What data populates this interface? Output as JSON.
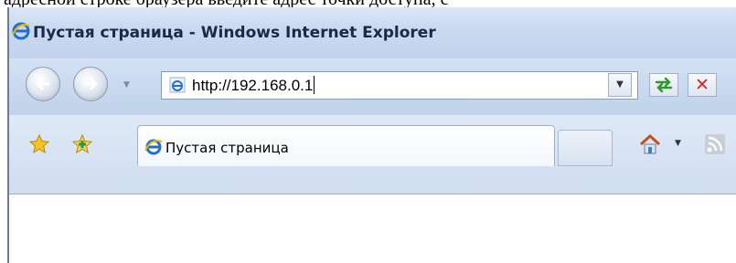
{
  "document": {
    "top_text": "адресной строке браузера введите адрес точки доступа, с"
  },
  "window": {
    "title": "Пустая страница - Windows Internet Explorer"
  },
  "address_bar": {
    "url": "http://192.168.0.1"
  },
  "tab": {
    "label": "Пустая страница"
  },
  "icons": {
    "title": "ie-logo-icon",
    "back": "back-arrow-icon",
    "forward": "forward-arrow-icon",
    "address": "ie-page-icon",
    "refresh": "refresh-icon",
    "stop": "stop-icon",
    "favorites": "favorites-star-icon",
    "add_favorite": "add-favorite-icon",
    "home": "home-icon",
    "feeds": "feeds-icon"
  },
  "colors": {
    "chrome": "#c9d9f0",
    "stop": "#d22222",
    "refresh": "#2a9a2a"
  }
}
